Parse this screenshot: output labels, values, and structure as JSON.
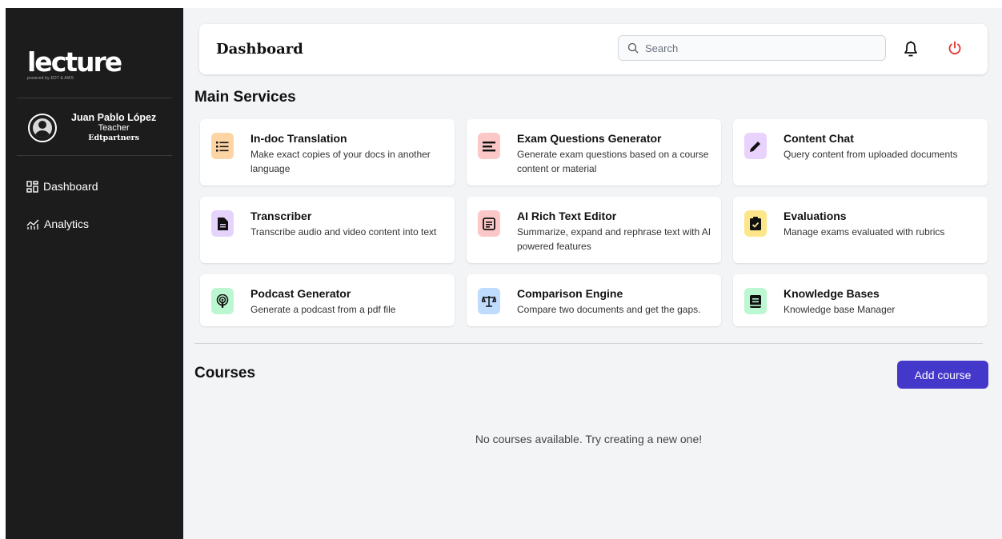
{
  "brand": {
    "name": "lecture",
    "tagline": "powered by EDT & AWS"
  },
  "user": {
    "name": "Juan Pablo López",
    "role": "Teacher",
    "org": "Edtpartners"
  },
  "nav": [
    {
      "label": "Dashboard",
      "icon": "dashboard-grid-icon"
    },
    {
      "label": "Analytics",
      "icon": "analytics-chart-icon"
    }
  ],
  "topbar": {
    "title": "Dashboard",
    "search_placeholder": "Search",
    "icons": [
      "search-icon",
      "bell-icon",
      "power-icon"
    ]
  },
  "colors": {
    "sidebar": "#1c1c1c",
    "accent": "#4338ca",
    "power": "#e53935",
    "page_bg": "#f3f4f6"
  },
  "main_services": {
    "title": "Main Services",
    "cards": [
      {
        "title": "In-doc Translation",
        "desc": "Make exact copies of your docs in another language",
        "icon": "list-icon",
        "icon_bg": "#fdd4a4"
      },
      {
        "title": "Exam Questions Generator",
        "desc": "Generate exam questions based on a course content or material",
        "icon": "lines-icon",
        "icon_bg": "#fbc7c7"
      },
      {
        "title": "Content Chat",
        "desc": "Query content from uploaded documents",
        "icon": "pencil-icon",
        "icon_bg": "#e9d2fb"
      },
      {
        "title": "Transcriber",
        "desc": "Transcribe audio and video content into text",
        "icon": "document-icon",
        "icon_bg": "#e5d3fc"
      },
      {
        "title": "AI Rich Text Editor",
        "desc": "Summarize, expand and rephrase text with AI powered features",
        "icon": "text-box-icon",
        "icon_bg": "#fbc7c7"
      },
      {
        "title": "Evaluations",
        "desc": "Manage exams evaluated with rubrics",
        "icon": "clipboard-check-icon",
        "icon_bg": "#fde68a"
      },
      {
        "title": "Podcast Generator",
        "desc": "Generate a podcast from a pdf file",
        "icon": "podcast-icon",
        "icon_bg": "#bbf7d0"
      },
      {
        "title": "Comparison Engine",
        "desc": "Compare two documents and get the gaps.",
        "icon": "scale-icon",
        "icon_bg": "#bfdbfe"
      },
      {
        "title": "Knowledge Bases",
        "desc": "Knowledge base Manager",
        "icon": "book-icon",
        "icon_bg": "#bbf7d0"
      }
    ]
  },
  "courses": {
    "title": "Courses",
    "add_label": "Add course",
    "empty_text": "No courses available. Try creating a new one!"
  }
}
